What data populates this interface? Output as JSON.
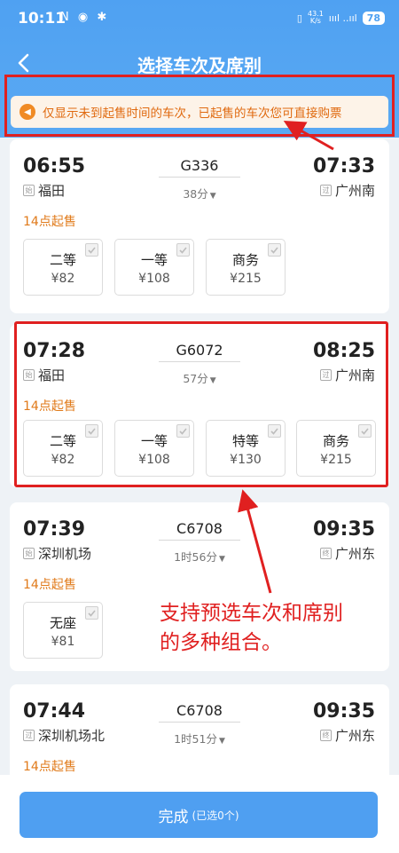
{
  "status_bar": {
    "time": "10:11",
    "left_icons": "N ◉ ✱",
    "speed_top": "43.1",
    "speed_unit": "K/s",
    "signal": "ıııl ..ııl",
    "battery": "78"
  },
  "nav": {
    "title": "选择车次及席别"
  },
  "notice": {
    "text": "仅显示未到起售时间的车次，已起售的车次您可直接购票"
  },
  "trains": [
    {
      "dep_time": "06:55",
      "arr_time": "07:33",
      "train_no": "G336",
      "duration": "38分",
      "dep_tag": "始",
      "dep_station": "福田",
      "arr_tag": "过",
      "arr_station": "广州南",
      "sale_time": "14点起售",
      "seats": [
        {
          "name": "二等",
          "price": "¥82"
        },
        {
          "name": "一等",
          "price": "¥108"
        },
        {
          "name": "商务",
          "price": "¥215"
        }
      ]
    },
    {
      "dep_time": "07:28",
      "arr_time": "08:25",
      "train_no": "G6072",
      "duration": "57分",
      "dep_tag": "始",
      "dep_station": "福田",
      "arr_tag": "过",
      "arr_station": "广州南",
      "sale_time": "14点起售",
      "seats": [
        {
          "name": "二等",
          "price": "¥82"
        },
        {
          "name": "一等",
          "price": "¥108"
        },
        {
          "name": "特等",
          "price": "¥130"
        },
        {
          "name": "商务",
          "price": "¥215"
        }
      ]
    },
    {
      "dep_time": "07:39",
      "arr_time": "09:35",
      "train_no": "C6708",
      "duration": "1时56分",
      "dep_tag": "始",
      "dep_station": "深圳机场",
      "arr_tag": "终",
      "arr_station": "广州东",
      "sale_time": "14点起售",
      "seats": [
        {
          "name": "无座",
          "price": "¥81"
        }
      ]
    },
    {
      "dep_time": "07:44",
      "arr_time": "09:35",
      "train_no": "C6708",
      "duration": "1时51分",
      "dep_tag": "过",
      "dep_station": "深圳机场北",
      "arr_tag": "终",
      "arr_station": "广州东",
      "sale_time": "14点起售"
    }
  ],
  "annotation": {
    "line1": "支持预选车次和席别",
    "line2": "的多种组合。"
  },
  "bottom": {
    "done_label": "完成",
    "done_sub": "(已选0个)"
  },
  "colors": {
    "header_blue": "#4fa1f2",
    "sale_orange": "#e07a1a",
    "annotation_red": "#e02020",
    "button_blue": "#4f9ff1"
  }
}
